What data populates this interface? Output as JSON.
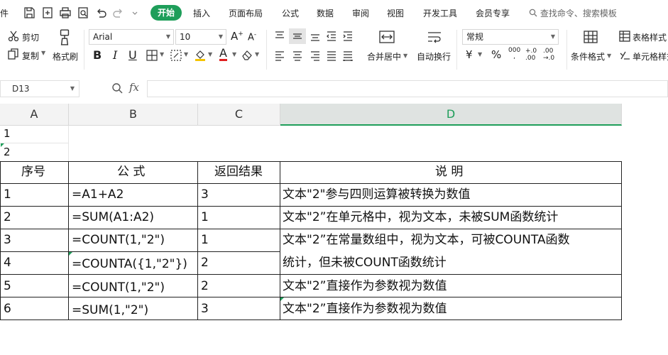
{
  "menu": {
    "file": "件",
    "active_tab": "开始",
    "tabs": [
      "插入",
      "页面布局",
      "公式",
      "数据",
      "审阅",
      "视图",
      "开发工具",
      "会员专享"
    ],
    "search": "查找命令、搜索模板"
  },
  "ribbon": {
    "cut": "剪切",
    "copy": "复制",
    "format_painter": "格式刷",
    "font_name": "Arial",
    "font_size": "10",
    "merge_center": "合并居中",
    "wrap_text": "自动换行",
    "number_format": "常规",
    "percent": "%",
    "thousands": "000",
    "inc_decimal": "+.0\n.00",
    "dec_decimal": ".00\n→.0",
    "conditional_format": "条件格式",
    "table_style": "表格样式",
    "cell_style": "单元格样式",
    "bold": "B",
    "italic": "I",
    "underline": "U",
    "font_color": "A"
  },
  "formula_bar": {
    "name_box": "D13",
    "fx": "fx",
    "content": ""
  },
  "sheet": {
    "columns": [
      "A",
      "B",
      "C",
      "D"
    ],
    "a1": "1",
    "a2": "2",
    "headers": [
      "序号",
      "公 式",
      "返回结果",
      "说 明"
    ],
    "rows": [
      {
        "no": "1",
        "formula": "=A1+A2",
        "result": "3",
        "desc": "文本\"2\"参与四则运算被转换为数值"
      },
      {
        "no": "2",
        "formula": "=SUM(A1:A2)",
        "result": "1",
        "desc": "文本\"2”在单元格中，视为文本，未被SUM函数统计"
      },
      {
        "no": "3",
        "formula": "=COUNT(1,\"2\")",
        "result": "1",
        "desc_line1": "文本\"2”在常量数组中，视为文本，可被COUNTA函数",
        "desc_line2": "统计，但未被COUNT函数统计"
      },
      {
        "no": "4",
        "formula": "=COUNTA({1,\"2\"})",
        "result": "2"
      },
      {
        "no": "5",
        "formula": "=COUNT(1,\"2\")",
        "result": "2",
        "desc": "文本\"2”直接作为参数视为数值"
      },
      {
        "no": "6",
        "formula": "=SUM(1,\"2\")",
        "result": "3",
        "desc": "文本\"2”直接作为参数视为数值"
      }
    ]
  },
  "colors": {
    "accent": "#1e9e5a",
    "header_bg": "#f3f3f3"
  }
}
